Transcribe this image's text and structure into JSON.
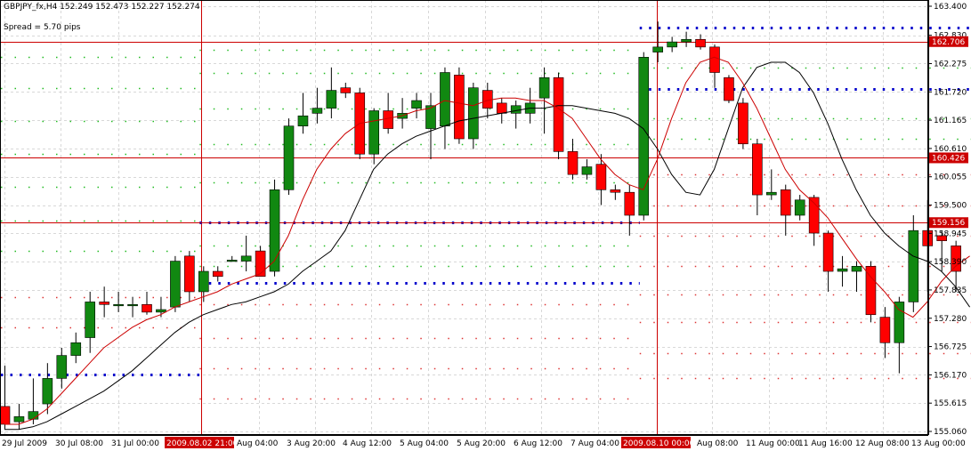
{
  "header": {
    "symbol_line": "GBPJPY_fx,H4  152.249 152.473 152.227 152.274",
    "spread": "Spread = 5.70 pips"
  },
  "colors": {
    "bull": "#118811",
    "bear": "#ff0000",
    "ma_fast": "#cc0000",
    "ma_slow": "#000000",
    "hline": "#cc0000",
    "pivot_blue": "#0000cc",
    "pivot_green": "#22bb22",
    "pivot_red": "#dd3333",
    "grid": "#d8d8d8"
  },
  "chart_data": {
    "type": "candlestick",
    "ylim": [
      155.06,
      163.4
    ],
    "y_ticks": [
      "163.400",
      "162.830",
      "162.275",
      "161.720",
      "161.165",
      "160.610",
      "160.055",
      "159.500",
      "158.945",
      "158.390",
      "157.835",
      "157.280",
      "156.725",
      "156.170",
      "155.615",
      "155.060"
    ],
    "x_ticks": [
      "29 Jul 2009",
      "30 Jul 08:00",
      "31 Jul 00:00",
      "2009.08.02 21:00",
      "Aug 04:00",
      "3 Aug 20:00",
      "4 Aug 12:00",
      "5 Aug 04:00",
      "5 Aug 20:00",
      "6 Aug 12:00",
      "7 Aug 04:00",
      "2009.08.10 00:00",
      "Aug 08:00",
      "11 Aug 00:00",
      "11 Aug 16:00",
      "12 Aug 08:00",
      "13 Aug 00:00"
    ],
    "highlighted_x_ticks": [
      "2009.08.02 21:00",
      "2009.08.10 00:00"
    ],
    "price_lines": [
      {
        "value": 162.706,
        "label": "162.706"
      },
      {
        "value": 160.426,
        "label": "160.426"
      },
      {
        "value": 159.156,
        "label": "159.156"
      }
    ],
    "candles": [
      {
        "o": 155.55,
        "h": 156.35,
        "l": 155.1,
        "c": 155.2
      },
      {
        "o": 155.25,
        "h": 155.6,
        "l": 155.1,
        "c": 155.35
      },
      {
        "o": 155.3,
        "h": 156.1,
        "l": 155.2,
        "c": 155.45
      },
      {
        "o": 155.6,
        "h": 156.4,
        "l": 155.4,
        "c": 156.1
      },
      {
        "o": 156.1,
        "h": 156.7,
        "l": 155.9,
        "c": 156.55
      },
      {
        "o": 156.55,
        "h": 157.0,
        "l": 156.4,
        "c": 156.8
      },
      {
        "o": 156.9,
        "h": 157.8,
        "l": 156.6,
        "c": 157.6
      },
      {
        "o": 157.6,
        "h": 157.9,
        "l": 157.3,
        "c": 157.55
      },
      {
        "o": 157.55,
        "h": 157.8,
        "l": 157.4,
        "c": 157.55
      },
      {
        "o": 157.55,
        "h": 157.7,
        "l": 157.3,
        "c": 157.55
      },
      {
        "o": 157.55,
        "h": 157.8,
        "l": 157.35,
        "c": 157.4
      },
      {
        "o": 157.4,
        "h": 157.7,
        "l": 157.3,
        "c": 157.45
      },
      {
        "o": 157.5,
        "h": 158.5,
        "l": 157.4,
        "c": 158.4
      },
      {
        "o": 158.5,
        "h": 158.6,
        "l": 157.6,
        "c": 157.8
      },
      {
        "o": 157.8,
        "h": 158.3,
        "l": 157.6,
        "c": 158.2
      },
      {
        "o": 158.2,
        "h": 158.3,
        "l": 158.0,
        "c": 158.1
      },
      {
        "o": 158.4,
        "h": 158.5,
        "l": 158.4,
        "c": 158.42
      },
      {
        "o": 158.4,
        "h": 158.9,
        "l": 158.2,
        "c": 158.5
      },
      {
        "o": 158.6,
        "h": 158.7,
        "l": 158.1,
        "c": 158.1
      },
      {
        "o": 158.2,
        "h": 160.0,
        "l": 158.1,
        "c": 159.8
      },
      {
        "o": 159.8,
        "h": 161.2,
        "l": 159.7,
        "c": 161.05
      },
      {
        "o": 161.05,
        "h": 161.7,
        "l": 160.9,
        "c": 161.25
      },
      {
        "o": 161.3,
        "h": 161.8,
        "l": 161.1,
        "c": 161.4
      },
      {
        "o": 161.4,
        "h": 162.2,
        "l": 161.2,
        "c": 161.75
      },
      {
        "o": 161.8,
        "h": 161.9,
        "l": 161.6,
        "c": 161.7
      },
      {
        "o": 161.7,
        "h": 161.8,
        "l": 160.4,
        "c": 160.5
      },
      {
        "o": 160.5,
        "h": 161.4,
        "l": 160.3,
        "c": 161.35
      },
      {
        "o": 161.35,
        "h": 161.7,
        "l": 160.9,
        "c": 161.0
      },
      {
        "o": 161.2,
        "h": 161.6,
        "l": 161.0,
        "c": 161.3
      },
      {
        "o": 161.4,
        "h": 161.7,
        "l": 161.2,
        "c": 161.55
      },
      {
        "o": 161.0,
        "h": 161.7,
        "l": 160.4,
        "c": 161.45
      },
      {
        "o": 161.05,
        "h": 162.2,
        "l": 160.6,
        "c": 162.1
      },
      {
        "o": 162.05,
        "h": 162.2,
        "l": 160.7,
        "c": 160.8
      },
      {
        "o": 160.8,
        "h": 161.9,
        "l": 160.6,
        "c": 161.8
      },
      {
        "o": 161.75,
        "h": 161.9,
        "l": 161.2,
        "c": 161.4
      },
      {
        "o": 161.5,
        "h": 161.6,
        "l": 161.1,
        "c": 161.3
      },
      {
        "o": 161.3,
        "h": 161.55,
        "l": 161.0,
        "c": 161.45
      },
      {
        "o": 161.3,
        "h": 161.8,
        "l": 161.1,
        "c": 161.5
      },
      {
        "o": 161.6,
        "h": 162.2,
        "l": 160.9,
        "c": 162.0
      },
      {
        "o": 162.0,
        "h": 162.1,
        "l": 160.4,
        "c": 160.55
      },
      {
        "o": 160.55,
        "h": 160.8,
        "l": 160.0,
        "c": 160.1
      },
      {
        "o": 160.1,
        "h": 160.4,
        "l": 160.0,
        "c": 160.25
      },
      {
        "o": 160.3,
        "h": 160.5,
        "l": 159.5,
        "c": 159.8
      },
      {
        "o": 159.8,
        "h": 159.9,
        "l": 159.6,
        "c": 159.75
      },
      {
        "o": 159.75,
        "h": 159.9,
        "l": 158.9,
        "c": 159.3
      },
      {
        "o": 159.3,
        "h": 162.5,
        "l": 159.2,
        "c": 162.4
      },
      {
        "o": 162.5,
        "h": 163.1,
        "l": 162.3,
        "c": 162.6
      },
      {
        "o": 162.6,
        "h": 162.8,
        "l": 162.5,
        "c": 162.7
      },
      {
        "o": 162.7,
        "h": 162.9,
        "l": 162.6,
        "c": 162.75
      },
      {
        "o": 162.75,
        "h": 162.85,
        "l": 162.55,
        "c": 162.6
      },
      {
        "o": 162.6,
        "h": 162.65,
        "l": 161.8,
        "c": 162.1
      },
      {
        "o": 162.0,
        "h": 162.05,
        "l": 161.5,
        "c": 161.55
      },
      {
        "o": 161.5,
        "h": 161.6,
        "l": 160.6,
        "c": 160.7
      },
      {
        "o": 160.7,
        "h": 160.8,
        "l": 159.3,
        "c": 159.7
      },
      {
        "o": 159.7,
        "h": 160.2,
        "l": 159.6,
        "c": 159.75
      },
      {
        "o": 159.8,
        "h": 159.9,
        "l": 158.9,
        "c": 159.3
      },
      {
        "o": 159.3,
        "h": 159.7,
        "l": 159.2,
        "c": 159.6
      },
      {
        "o": 159.65,
        "h": 159.7,
        "l": 158.7,
        "c": 158.95
      },
      {
        "o": 158.95,
        "h": 159.0,
        "l": 157.8,
        "c": 158.2
      },
      {
        "o": 158.2,
        "h": 158.5,
        "l": 157.9,
        "c": 158.25
      },
      {
        "o": 158.2,
        "h": 158.4,
        "l": 157.8,
        "c": 158.3
      },
      {
        "o": 158.3,
        "h": 158.4,
        "l": 157.2,
        "c": 157.35
      },
      {
        "o": 157.3,
        "h": 157.5,
        "l": 156.5,
        "c": 156.8
      },
      {
        "o": 156.8,
        "h": 157.7,
        "l": 156.2,
        "c": 157.6
      },
      {
        "o": 157.6,
        "h": 159.3,
        "l": 157.4,
        "c": 159.0
      },
      {
        "o": 159.0,
        "h": 159.6,
        "l": 157.8,
        "c": 158.7
      },
      {
        "o": 158.9,
        "h": 159.0,
        "l": 158.2,
        "c": 158.8
      },
      {
        "o": 158.7,
        "h": 158.8,
        "l": 157.8,
        "c": 158.2
      }
    ],
    "ma_fast": [
      155.2,
      155.2,
      155.3,
      155.5,
      155.8,
      156.1,
      156.4,
      156.7,
      156.9,
      157.1,
      157.25,
      157.35,
      157.5,
      157.6,
      157.7,
      157.8,
      157.95,
      158.05,
      158.15,
      158.4,
      158.9,
      159.6,
      160.2,
      160.6,
      160.9,
      161.1,
      161.15,
      161.2,
      161.25,
      161.35,
      161.4,
      161.55,
      161.5,
      161.45,
      161.55,
      161.6,
      161.6,
      161.55,
      161.55,
      161.4,
      161.2,
      160.8,
      160.4,
      160.1,
      159.9,
      159.8,
      160.4,
      161.2,
      161.9,
      162.3,
      162.4,
      162.3,
      161.9,
      161.4,
      160.8,
      160.2,
      159.8,
      159.55,
      159.25,
      158.85,
      158.45,
      158.1,
      157.8,
      157.45,
      157.3,
      157.6,
      158.0,
      158.3,
      158.5
    ],
    "ma_slow": [
      155.1,
      155.1,
      155.15,
      155.25,
      155.4,
      155.55,
      155.7,
      155.85,
      156.05,
      156.25,
      156.5,
      156.75,
      157.0,
      157.2,
      157.35,
      157.45,
      157.55,
      157.6,
      157.7,
      157.8,
      157.95,
      158.2,
      158.4,
      158.6,
      159.0,
      159.6,
      160.2,
      160.5,
      160.7,
      160.85,
      160.95,
      161.05,
      161.15,
      161.2,
      161.25,
      161.3,
      161.35,
      161.4,
      161.4,
      161.45,
      161.45,
      161.4,
      161.35,
      161.3,
      161.2,
      161.0,
      160.6,
      160.1,
      159.75,
      159.7,
      160.2,
      161.0,
      161.8,
      162.2,
      162.3,
      162.3,
      162.1,
      161.7,
      161.1,
      160.4,
      159.8,
      159.3,
      158.95,
      158.7,
      158.5,
      158.4,
      158.2,
      157.9,
      157.5
    ],
    "pivot_levels": [
      {
        "start": 0,
        "end": 14,
        "lines": [
          {
            "value": 156.17,
            "color": "blue"
          },
          {
            "value": 157.1,
            "color": "red"
          },
          {
            "value": 157.7,
            "color": "red"
          },
          {
            "value": 158.6,
            "color": "green"
          },
          {
            "value": 159.2,
            "color": "green"
          },
          {
            "value": 159.85,
            "color": "green"
          },
          {
            "value": 160.5,
            "color": "green"
          },
          {
            "value": 161.15,
            "color": "green"
          },
          {
            "value": 161.8,
            "color": "green"
          },
          {
            "value": 162.4,
            "color": "green"
          }
        ]
      },
      {
        "start": 14,
        "end": 45,
        "lines": [
          {
            "value": 155.7,
            "color": "red"
          },
          {
            "value": 156.3,
            "color": "red"
          },
          {
            "value": 156.9,
            "color": "red"
          },
          {
            "value": 157.55,
            "color": "red"
          },
          {
            "value": 157.98,
            "color": "blue"
          },
          {
            "value": 158.3,
            "color": "green"
          },
          {
            "value": 158.7,
            "color": "green"
          },
          {
            "value": 159.16,
            "color": "blue"
          },
          {
            "value": 159.95,
            "color": "green"
          },
          {
            "value": 160.7,
            "color": "green"
          },
          {
            "value": 161.4,
            "color": "green"
          },
          {
            "value": 162.1,
            "color": "green"
          },
          {
            "value": 162.55,
            "color": "green"
          }
        ]
      },
      {
        "start": 45,
        "end": 69,
        "lines": [
          {
            "value": 156.1,
            "color": "red"
          },
          {
            "value": 156.6,
            "color": "red"
          },
          {
            "value": 157.2,
            "color": "red"
          },
          {
            "value": 157.75,
            "color": "red"
          },
          {
            "value": 158.3,
            "color": "red"
          },
          {
            "value": 158.9,
            "color": "red"
          },
          {
            "value": 159.5,
            "color": "red"
          },
          {
            "value": 160.1,
            "color": "red"
          },
          {
            "value": 160.8,
            "color": "green"
          },
          {
            "value": 161.2,
            "color": "green"
          },
          {
            "value": 161.78,
            "color": "blue"
          },
          {
            "value": 162.2,
            "color": "green"
          },
          {
            "value": 162.98,
            "color": "blue"
          }
        ]
      }
    ]
  }
}
